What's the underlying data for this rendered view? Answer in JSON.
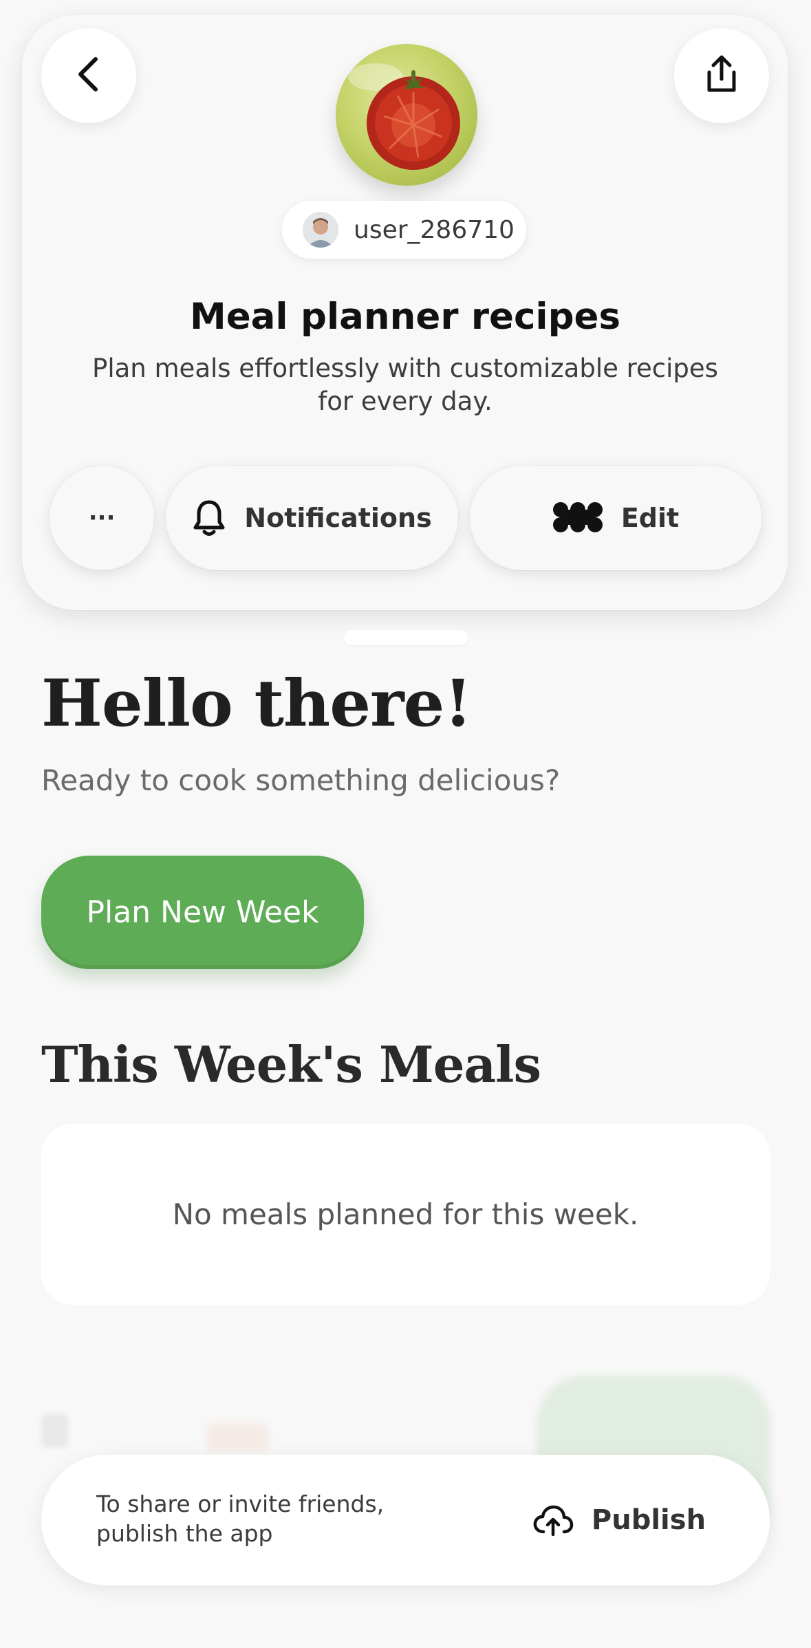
{
  "header": {
    "username": "user_286710",
    "title": "Meal planner recipes",
    "description": "Plan meals effortlessly with customizable recipes for every day.",
    "actions": {
      "more_label": "···",
      "notifications_label": "Notifications",
      "edit_label": "Edit"
    }
  },
  "main": {
    "greeting": "Hello there!",
    "subtitle": "Ready to cook something delicious?",
    "plan_button": "Plan New Week",
    "section_title": "This Week's Meals",
    "empty_state": "No meals planned for this week."
  },
  "publish_bar": {
    "message": "To share or invite friends, publish the app",
    "button": "Publish"
  },
  "colors": {
    "accent_green": "#5fac57",
    "background": "#f8f8f8",
    "card": "#ffffff"
  },
  "icons": [
    "back-icon",
    "share-icon",
    "bell-icon",
    "edit-blob-icon",
    "cloud-upload-icon",
    "tomato-app-icon"
  ]
}
